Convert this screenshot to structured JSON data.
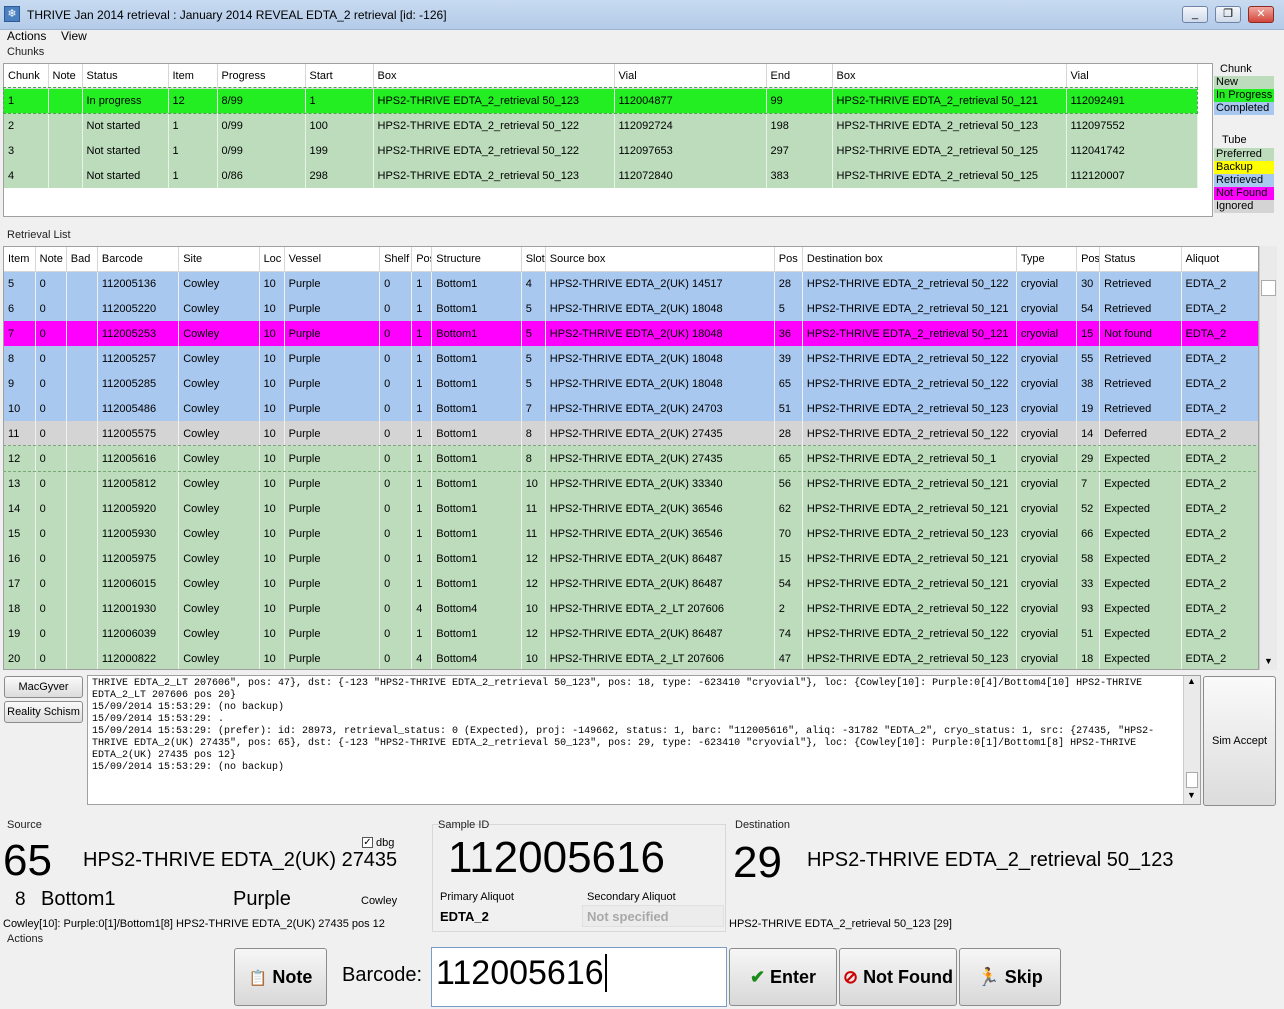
{
  "window": {
    "title": "THRIVE Jan 2014 retrieval : January 2014 REVEAL EDTA_2 retrieval [id: -126]",
    "minimize": "_",
    "restore": "❐",
    "close": "✕"
  },
  "menu": [
    "Actions",
    "View"
  ],
  "chunks": {
    "label": "Chunks",
    "columns": [
      "Chunk",
      "Note",
      "Status",
      "Item",
      "Progress",
      "Start",
      "Box",
      "Vial",
      "End",
      "Box",
      "Vial"
    ],
    "rows": [
      {
        "cells": [
          "1",
          "",
          "In progress",
          "12",
          "8/99",
          "1",
          "HPS2-THRIVE EDTA_2_retrieval 50_123",
          "112004877",
          "99",
          "HPS2-THRIVE EDTA_2_retrieval 50_121",
          "112092491"
        ],
        "state": "inprogress"
      },
      {
        "cells": [
          "2",
          "",
          "Not started",
          "1",
          "0/99",
          "100",
          "HPS2-THRIVE EDTA_2_retrieval 50_122",
          "112092724",
          "198",
          "HPS2-THRIVE EDTA_2_retrieval 50_123",
          "112097552"
        ],
        "state": "new"
      },
      {
        "cells": [
          "3",
          "",
          "Not started",
          "1",
          "0/99",
          "199",
          "HPS2-THRIVE EDTA_2_retrieval 50_122",
          "112097653",
          "297",
          "HPS2-THRIVE EDTA_2_retrieval 50_125",
          "112041742"
        ],
        "state": "new"
      },
      {
        "cells": [
          "4",
          "",
          "Not started",
          "1",
          "0/86",
          "298",
          "HPS2-THRIVE EDTA_2_retrieval 50_123",
          "112072840",
          "383",
          "HPS2-THRIVE EDTA_2_retrieval 50_125",
          "112120007"
        ],
        "state": "new"
      }
    ]
  },
  "legend": {
    "chunk_title": "Chunk",
    "chunk": [
      {
        "label": "New",
        "color": "#bcdcbc"
      },
      {
        "label": "In Progress",
        "color": "#22ee22"
      },
      {
        "label": "Completed",
        "color": "#a8c8f0"
      }
    ],
    "tube_title": "Tube",
    "tube": [
      {
        "label": "Preferred",
        "color": "#bcdcbc"
      },
      {
        "label": "Backup",
        "color": "#ffff00"
      },
      {
        "label": "Retrieved",
        "color": "#a8c8f0"
      },
      {
        "label": "Not Found",
        "color": "#ff00ff"
      },
      {
        "label": "Ignored",
        "color": "#d4d4d4"
      }
    ]
  },
  "colors": {
    "new": "#bcdcbc",
    "inprogress": "#22ee22",
    "retrieved": "#a8c8f0",
    "notfound": "#ff00ff",
    "deferred": "#d4d4d4",
    "expected": "#bcdcbc"
  },
  "retrieval": {
    "label": "Retrieval List",
    "columns": [
      "Item",
      "Note",
      "Bad",
      "Barcode",
      "Site",
      "Loc",
      "Vessel",
      "Shelf",
      "Pos",
      "Structure",
      "Slot",
      "Source box",
      "Pos",
      "Destination box",
      "Type",
      "Pos",
      "Status",
      "Aliquot"
    ],
    "rows": [
      {
        "cells": [
          "5",
          "0",
          "",
          "112005136",
          "Cowley",
          "10",
          "Purple",
          "0",
          "1",
          "Bottom1",
          "4",
          "HPS2-THRIVE EDTA_2(UK) 14517",
          "28",
          "HPS2-THRIVE EDTA_2_retrieval 50_122",
          "cryovial",
          "30",
          "Retrieved",
          "EDTA_2"
        ],
        "state": "retrieved"
      },
      {
        "cells": [
          "6",
          "0",
          "",
          "112005220",
          "Cowley",
          "10",
          "Purple",
          "0",
          "1",
          "Bottom1",
          "5",
          "HPS2-THRIVE EDTA_2(UK) 18048",
          "5",
          "HPS2-THRIVE EDTA_2_retrieval 50_121",
          "cryovial",
          "54",
          "Retrieved",
          "EDTA_2"
        ],
        "state": "retrieved"
      },
      {
        "cells": [
          "7",
          "0",
          "",
          "112005253",
          "Cowley",
          "10",
          "Purple",
          "0",
          "1",
          "Bottom1",
          "5",
          "HPS2-THRIVE EDTA_2(UK) 18048",
          "36",
          "HPS2-THRIVE EDTA_2_retrieval 50_121",
          "cryovial",
          "15",
          "Not found",
          "EDTA_2"
        ],
        "state": "notfound"
      },
      {
        "cells": [
          "8",
          "0",
          "",
          "112005257",
          "Cowley",
          "10",
          "Purple",
          "0",
          "1",
          "Bottom1",
          "5",
          "HPS2-THRIVE EDTA_2(UK) 18048",
          "39",
          "HPS2-THRIVE EDTA_2_retrieval 50_122",
          "cryovial",
          "55",
          "Retrieved",
          "EDTA_2"
        ],
        "state": "retrieved"
      },
      {
        "cells": [
          "9",
          "0",
          "",
          "112005285",
          "Cowley",
          "10",
          "Purple",
          "0",
          "1",
          "Bottom1",
          "5",
          "HPS2-THRIVE EDTA_2(UK) 18048",
          "65",
          "HPS2-THRIVE EDTA_2_retrieval 50_122",
          "cryovial",
          "38",
          "Retrieved",
          "EDTA_2"
        ],
        "state": "retrieved"
      },
      {
        "cells": [
          "10",
          "0",
          "",
          "112005486",
          "Cowley",
          "10",
          "Purple",
          "0",
          "1",
          "Bottom1",
          "7",
          "HPS2-THRIVE EDTA_2(UK) 24703",
          "51",
          "HPS2-THRIVE EDTA_2_retrieval 50_123",
          "cryovial",
          "19",
          "Retrieved",
          "EDTA_2"
        ],
        "state": "retrieved"
      },
      {
        "cells": [
          "11",
          "0",
          "",
          "112005575",
          "Cowley",
          "10",
          "Purple",
          "0",
          "1",
          "Bottom1",
          "8",
          "HPS2-THRIVE EDTA_2(UK) 27435",
          "28",
          "HPS2-THRIVE EDTA_2_retrieval 50_122",
          "cryovial",
          "14",
          "Deferred",
          "EDTA_2"
        ],
        "state": "deferred"
      },
      {
        "cells": [
          "12",
          "0",
          "",
          "112005616",
          "Cowley",
          "10",
          "Purple",
          "0",
          "1",
          "Bottom1",
          "8",
          "HPS2-THRIVE EDTA_2(UK) 27435",
          "65",
          "HPS2-THRIVE EDTA_2_retrieval 50_1",
          "cryovial",
          "29",
          "Expected",
          "EDTA_2"
        ],
        "state": "current"
      },
      {
        "cells": [
          "13",
          "0",
          "",
          "112005812",
          "Cowley",
          "10",
          "Purple",
          "0",
          "1",
          "Bottom1",
          "10",
          "HPS2-THRIVE EDTA_2(UK) 33340",
          "56",
          "HPS2-THRIVE EDTA_2_retrieval 50_121",
          "cryovial",
          "7",
          "Expected",
          "EDTA_2"
        ],
        "state": "expected"
      },
      {
        "cells": [
          "14",
          "0",
          "",
          "112005920",
          "Cowley",
          "10",
          "Purple",
          "0",
          "1",
          "Bottom1",
          "11",
          "HPS2-THRIVE EDTA_2(UK) 36546",
          "62",
          "HPS2-THRIVE EDTA_2_retrieval 50_121",
          "cryovial",
          "52",
          "Expected",
          "EDTA_2"
        ],
        "state": "expected"
      },
      {
        "cells": [
          "15",
          "0",
          "",
          "112005930",
          "Cowley",
          "10",
          "Purple",
          "0",
          "1",
          "Bottom1",
          "11",
          "HPS2-THRIVE EDTA_2(UK) 36546",
          "70",
          "HPS2-THRIVE EDTA_2_retrieval 50_123",
          "cryovial",
          "66",
          "Expected",
          "EDTA_2"
        ],
        "state": "expected"
      },
      {
        "cells": [
          "16",
          "0",
          "",
          "112005975",
          "Cowley",
          "10",
          "Purple",
          "0",
          "1",
          "Bottom1",
          "12",
          "HPS2-THRIVE EDTA_2(UK) 86487",
          "15",
          "HPS2-THRIVE EDTA_2_retrieval 50_121",
          "cryovial",
          "58",
          "Expected",
          "EDTA_2"
        ],
        "state": "expected"
      },
      {
        "cells": [
          "17",
          "0",
          "",
          "112006015",
          "Cowley",
          "10",
          "Purple",
          "0",
          "1",
          "Bottom1",
          "12",
          "HPS2-THRIVE EDTA_2(UK) 86487",
          "54",
          "HPS2-THRIVE EDTA_2_retrieval 50_121",
          "cryovial",
          "33",
          "Expected",
          "EDTA_2"
        ],
        "state": "expected"
      },
      {
        "cells": [
          "18",
          "0",
          "",
          "112001930",
          "Cowley",
          "10",
          "Purple",
          "0",
          "4",
          "Bottom4",
          "10",
          "HPS2-THRIVE EDTA_2_LT 207606",
          "2",
          "HPS2-THRIVE EDTA_2_retrieval 50_122",
          "cryovial",
          "93",
          "Expected",
          "EDTA_2"
        ],
        "state": "expected"
      },
      {
        "cells": [
          "19",
          "0",
          "",
          "112006039",
          "Cowley",
          "10",
          "Purple",
          "0",
          "1",
          "Bottom1",
          "12",
          "HPS2-THRIVE EDTA_2(UK) 86487",
          "74",
          "HPS2-THRIVE EDTA_2_retrieval 50_122",
          "cryovial",
          "51",
          "Expected",
          "EDTA_2"
        ],
        "state": "expected"
      },
      {
        "cells": [
          "20",
          "0",
          "",
          "112000822",
          "Cowley",
          "10",
          "Purple",
          "0",
          "4",
          "Bottom4",
          "10",
          "HPS2-THRIVE EDTA_2_LT 207606",
          "47",
          "HPS2-THRIVE EDTA_2_retrieval 50_123",
          "cryovial",
          "18",
          "Expected",
          "EDTA_2"
        ],
        "state": "expected"
      }
    ]
  },
  "side_buttons": {
    "macgyver": "MacGyver",
    "reality": "Reality Schism",
    "sim_accept": "Sim Accept"
  },
  "log_lines": [
    "THRIVE EDTA_2_LT 207606\", pos: 47}, dst: {-123 \"HPS2-THRIVE EDTA_2_retrieval 50_123\", pos: 18, type: -623410 \"cryovial\"}, loc: {Cowley[10]: Purple:0[4]/Bottom4[10] HPS2-THRIVE",
    "EDTA_2_LT 207606 pos 20}",
    "15/09/2014 15:53:29: (no backup)",
    "15/09/2014 15:53:29: .",
    "15/09/2014 15:53:29: (prefer): id: 28973, retrieval_status: 0 (Expected), proj: -149662, status: 1, barc: \"112005616\", aliq: -31782 \"EDTA_2\", cryo_status: 1, src: {27435, \"HPS2-",
    "THRIVE EDTA_2(UK) 27435\", pos: 65}, dst: {-123 \"HPS2-THRIVE EDTA_2_retrieval 50_123\", pos: 29, type: -623410 \"cryovial\"}, loc: {Cowley[10]: Purple:0[1]/Bottom1[8] HPS2-THRIVE",
    "EDTA_2(UK) 27435 pos 12}",
    "15/09/2014 15:53:29: (no backup)"
  ],
  "source": {
    "label": "Source",
    "pos": "65",
    "box": "HPS2-THRIVE EDTA_2(UK) 27435",
    "dbg_label": "dbg",
    "slot": "8",
    "structure": "Bottom1",
    "vessel": "Purple",
    "site": "Cowley",
    "location_line": "Cowley[10]: Purple:0[1]/Bottom1[8] HPS2-THRIVE EDTA_2(UK) 27435 pos 12"
  },
  "sample": {
    "label": "Sample ID",
    "id": "112005616",
    "primary_label": "Primary Aliquot",
    "primary_value": "EDTA_2",
    "secondary_label": "Secondary Aliquot",
    "secondary_value": "Not specified"
  },
  "destination": {
    "label": "Destination",
    "pos": "29",
    "box": "HPS2-THRIVE EDTA_2_retrieval 50_123",
    "line": "HPS2-THRIVE EDTA_2_retrieval 50_123 [29]"
  },
  "actions": {
    "label": "Actions",
    "note": "Note",
    "barcode_label": "Barcode:",
    "barcode_value": "112005616",
    "enter": "Enter",
    "not_found": "Not Found",
    "skip": "Skip"
  }
}
